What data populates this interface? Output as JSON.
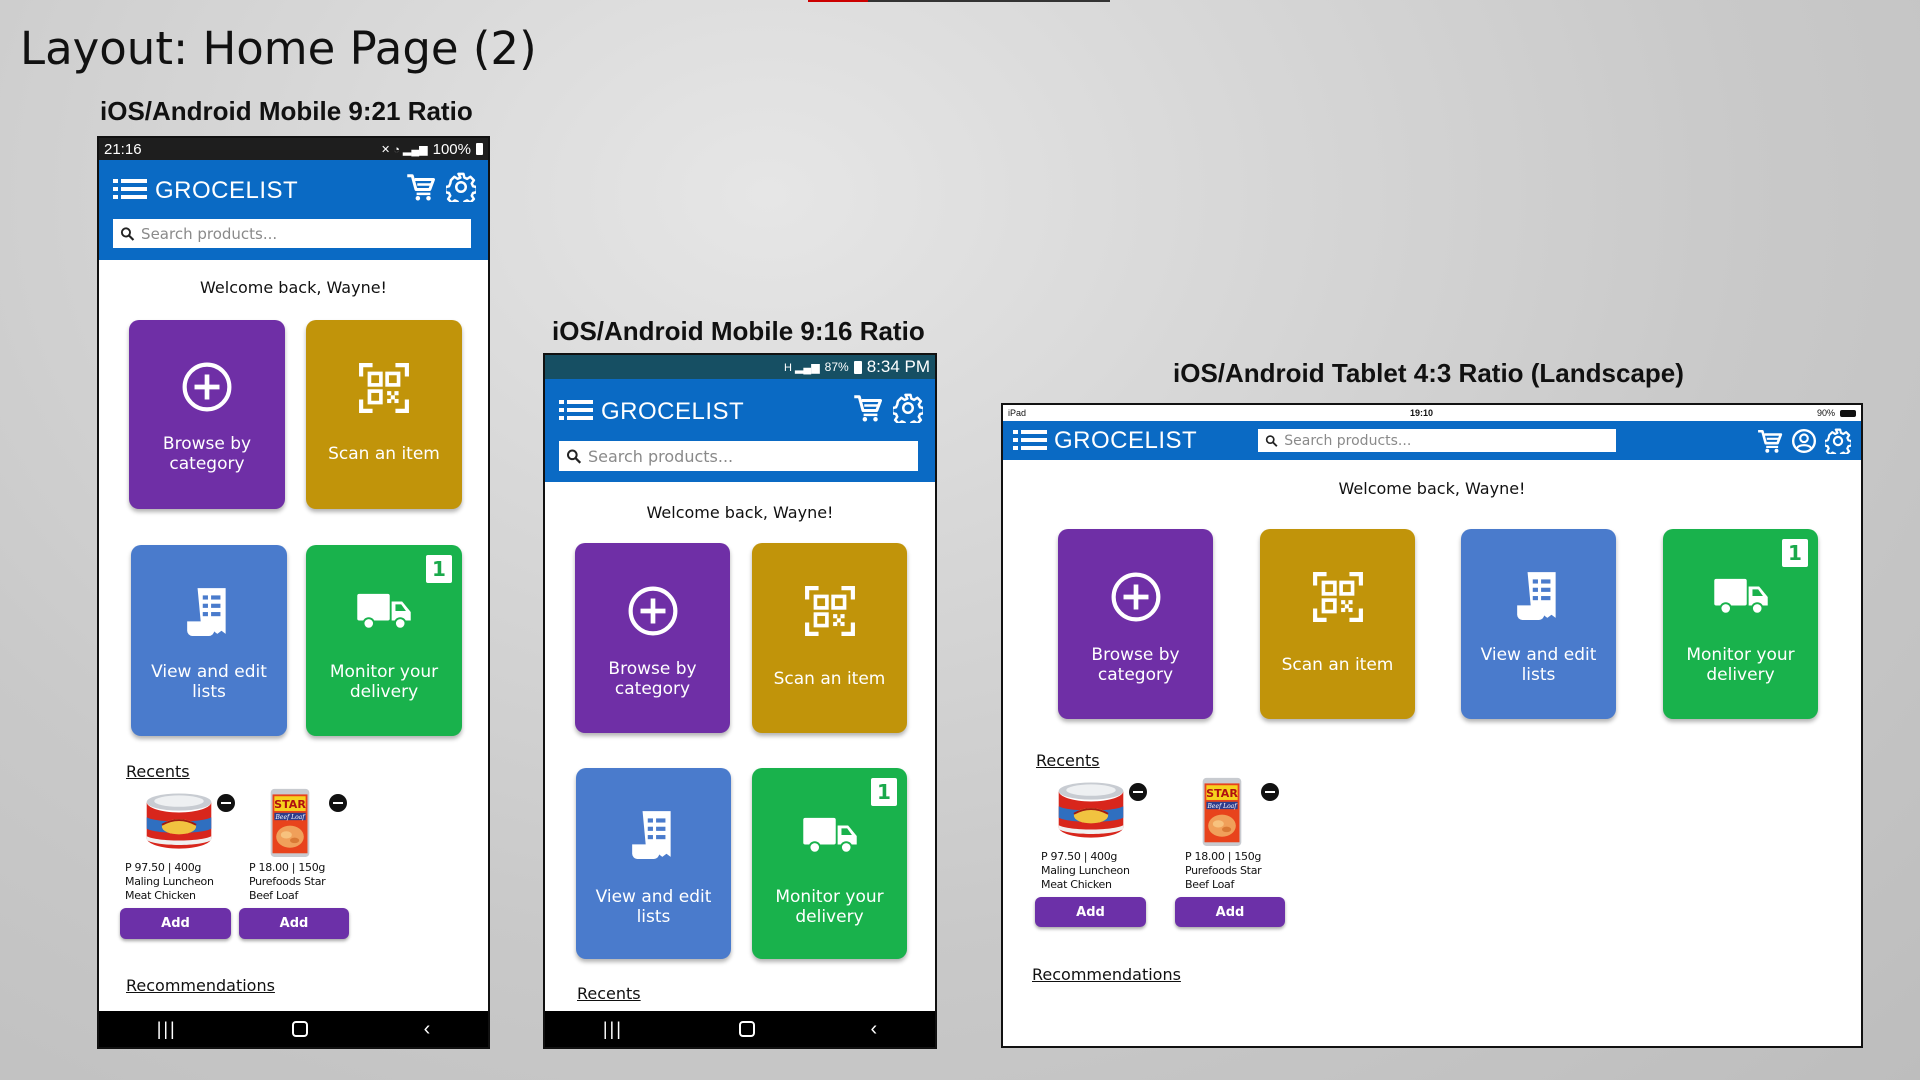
{
  "slide_title": "Layout: Home Page (2)",
  "labels": {
    "mobile_21": "iOS/Android Mobile 9:21 Ratio",
    "mobile_16": "iOS/Android Mobile 9:16 Ratio",
    "tablet": "iOS/Android Tablet 4:3 Ratio (Landscape)"
  },
  "colors": {
    "appbar": "#0a6ac4",
    "browse": "#6f2fa6",
    "scan": "#c1940a",
    "lists": "#4a7bcc",
    "delivery": "#19b24c",
    "add_button": "#6c30a8"
  },
  "app": {
    "brand": "GROCELIST",
    "search_placeholder": "Search products...",
    "welcome": "Welcome back, Wayne!",
    "tiles": {
      "browse": "Browse by category",
      "scan": "Scan an item",
      "lists": "View and edit lists",
      "delivery": "Monitor your delivery",
      "delivery_badge": "1"
    },
    "recents_title": "Recents",
    "recommendations_title": "Recommendations",
    "products": [
      {
        "price": "P 97.50 | 400g",
        "name_line1": "Maling Luncheon",
        "name_line2": "Meat Chicken",
        "add": "Add",
        "brand_text": "Ma-Ling"
      },
      {
        "price": "P 18.00 | 150g",
        "name_line1": "Purefoods Star",
        "name_line2": "Beef Loaf",
        "add": "Add",
        "brand_text": "STAR",
        "brand_sub": "Beef Loaf"
      }
    ]
  },
  "status": {
    "m21": {
      "time": "21:16",
      "battery": "100%"
    },
    "m16": {
      "time": "8:34 PM",
      "battery": "87%"
    },
    "tablet": {
      "device": "iPad",
      "time": "19:10",
      "battery": "90%"
    }
  }
}
